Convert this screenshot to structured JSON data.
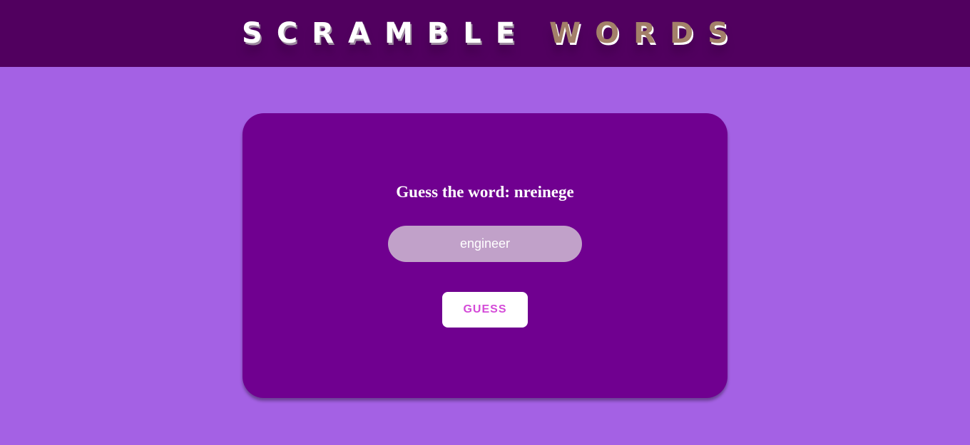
{
  "header": {
    "title_part_1": "SCRAMBLE",
    "title_part_2": "WORDS"
  },
  "game": {
    "prompt_label": "Guess the word:",
    "scrambled_word": "nreinege",
    "input_value": "engineer",
    "guess_button_label": "GUESS"
  },
  "colors": {
    "page_background": "#a461e4",
    "header_background": "#51005f",
    "card_background": "#700090",
    "input_background": "#c1a1c9",
    "button_text": "#d44ad8",
    "title_accent": "#a38069"
  }
}
